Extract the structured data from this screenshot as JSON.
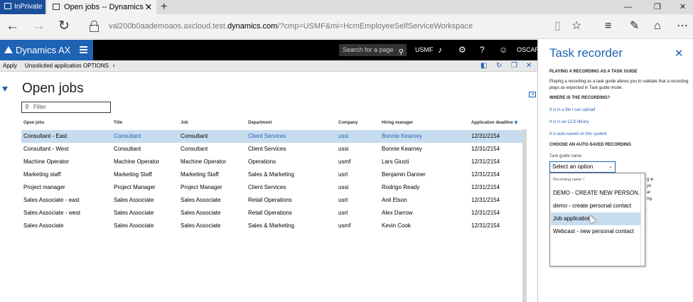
{
  "browser": {
    "inprivate_label": "InPrivate",
    "tab_title": "Open jobs -- Dynamics '",
    "tab_close": "✕",
    "new_tab": "+",
    "url_prefix": "val200b0aademoaos.axcloud.test.",
    "url_domain": "dynamics.com",
    "url_suffix": "/?cmp=USMF&mi=HcmEmployeeSelfServiceWorkspace",
    "back": "←",
    "forward": "→",
    "refresh": "↻",
    "minimize": "—",
    "restore": "❐",
    "close": "✕"
  },
  "navbar": {
    "app_name": "Dynamics AX",
    "search_placeholder": "Search for a page",
    "company": "USMF",
    "user": "OSCAR"
  },
  "actions": {
    "apply": "Apply",
    "unsolicited": "Unsolicited application",
    "options": "OPTIONS"
  },
  "page": {
    "title": "Open jobs",
    "filter_placeholder": "Filter"
  },
  "table": {
    "headers": [
      "Open jobs",
      "Title",
      "Job",
      "Department",
      "Company",
      "Hiring manager",
      "Application deadline"
    ],
    "rows": [
      [
        "Consultant - East",
        "Consultant",
        "Consultant",
        "Client Services",
        "ussi",
        "Bonnie Kearney",
        "12/31/2154"
      ],
      [
        "Consultant - West",
        "Consultant",
        "Consultant",
        "Client Services",
        "ussi",
        "Bonnie Kearney",
        "12/31/2154"
      ],
      [
        "Machine Operator",
        "Machine Operator",
        "Machine Operator",
        "Operations",
        "usmf",
        "Lars Giusti",
        "12/31/2154"
      ],
      [
        "Marketing staff",
        "Marketing Staff",
        "Marketing Staff",
        "Sales & Marketing",
        "usrt",
        "Benjamin Danner",
        "12/31/2154"
      ],
      [
        "Project manager",
        "Project Manager",
        "Project Manager",
        "Client Services",
        "ussi",
        "Rodrigo Ready",
        "12/31/2154"
      ],
      [
        "Sales Associate - east",
        "Sales Associate",
        "Sales Associate",
        "Retail Operations",
        "usrt",
        "Anil Elson",
        "12/31/2154"
      ],
      [
        "Sales Associate - west",
        "Sales Associate",
        "Sales Associate",
        "Retail Operations",
        "usrt",
        "Alex Darrow",
        "12/31/2154"
      ],
      [
        "Sales Associate",
        "Sales Associate",
        "Sales Associate",
        "Sales & Marketing",
        "usmf",
        "Kevin Cook",
        "12/31/2154"
      ]
    ],
    "selected_row": 0
  },
  "task_recorder": {
    "title": "Task recorder",
    "close": "✕",
    "section_playing": "PLAYING A RECORDING AS A TASK GUIDE",
    "playing_text": "Playing a recording as a task guide allows you to validate that a recording plays as expected in Task guide mode.",
    "section_where": "WHERE IS THE RECORDING?",
    "link_file": "It is in a file I can upload",
    "link_lcs": "It is in an LCS library",
    "link_auto": "It is auto-saved on this system",
    "section_choose": "CHOOSE AN AUTO-SAVED RECORDING",
    "guide_name_label": "Task guide name",
    "select_value": "Select an option",
    "dropdown_header": "Recording name",
    "dropdown_items": [
      "DEMO - CREATE NEW PERSON...",
      "demo - create personal contact",
      "Job application",
      "Webcast - new personal contact"
    ],
    "highlighted_item": 2,
    "peek_lines": [
      "g w",
      "yo",
      "al",
      "ng."
    ]
  },
  "colors": {
    "accent": "#1e63b4",
    "selection": "#c7dcef",
    "inprivate": "#1a4f9a"
  }
}
